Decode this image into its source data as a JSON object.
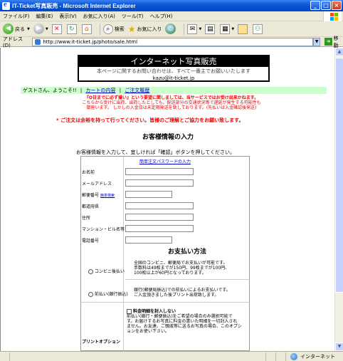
{
  "window": {
    "title": "IT-Ticket写真販売 - Microsoft Internet Explorer",
    "controls": [
      "_",
      "□",
      "×"
    ]
  },
  "menu": [
    "ファイル(F)",
    "編集(E)",
    "表示(V)",
    "お気に入り(A)",
    "ツール(T)",
    "ヘルプ(H)"
  ],
  "toolbar": {
    "back": "戻る",
    "search": "検索",
    "favorites": "お気に入り"
  },
  "address": {
    "label": "アドレス(D)",
    "url": "http://www.it-ticket.jp/photo/sale.html",
    "go": "移動"
  },
  "page": {
    "banner_title": "インターネット写真販売",
    "banner_note": "本ページに関するお問い合わせは、すべて一番主でお願いいたします",
    "banner_mail": "kazu@it-ticket.jp",
    "greeting": "ゲストさん、ようこそ!!",
    "link_cart": "カートの内容",
    "link_history": "ご注文履歴",
    "notice_1": "『O日までに必ず撮い』という要望に関しましては、当サービスではお受け出来かねます。",
    "notice_2": "こちらから受けに出荷、出荷したとしても、配送部分の交通状況等で遅延が発生する可能性も",
    "notice_3": "御座います。 しかしの入金日は未定期発送を致しております。(先払いは入金確認後発送)",
    "notice_4": "* ご注文は余裕を持って行ってください。皆様のご理解とご協力をお願い致します。",
    "heading_customer": "お客様情報の入力",
    "intro": "お客様情報を入力して、宜しければ「確認」ボタンを押してください。",
    "password_link": "簡単注文パスワードの入力",
    "fields": [
      {
        "label": "お名前"
      },
      {
        "label": "メールアドレス"
      },
      {
        "label": "郵便番号",
        "extra": "簡単検索"
      },
      {
        "label": "都道府県"
      },
      {
        "label": "住所"
      },
      {
        "label": "マンション・ビル名等"
      },
      {
        "label": "電話番号"
      }
    ],
    "heading_payment": "お支払い方法",
    "pay_conv_label": "コンビニ後払い",
    "pay_conv_text_1": "全国のコンビニ、郵便局でお支払いが可能です。",
    "pay_conv_text_2": "手数料は49枚までが150円、99枚までが100円、",
    "pay_conv_text_3": "100枚以上が60円となっております。",
    "pay_bank_label": "前払い(銀行振込)",
    "pay_bank_text_1": "銀行(郵便局振込)での前払いによるお支払いです。",
    "pay_bank_text_2": "ご入金頂きました後プリント出荷致します。",
    "print_option_label": "プリントオプション",
    "print_option_title": "料金明細を封入しない",
    "print_option_text_1": "前払い(銀行・郵便振込)をご希望の場合のみ選択可能で",
    "print_option_text_2": "す。お届けするお写真に料金の書いた明細を一切封入され",
    "print_option_text_3": "ません。お友達、ご親戚等に送るお写真の場合、このオプシ",
    "print_option_text_4": "ョンをお使い下さい。"
  },
  "status": {
    "zone": "インターネット"
  }
}
